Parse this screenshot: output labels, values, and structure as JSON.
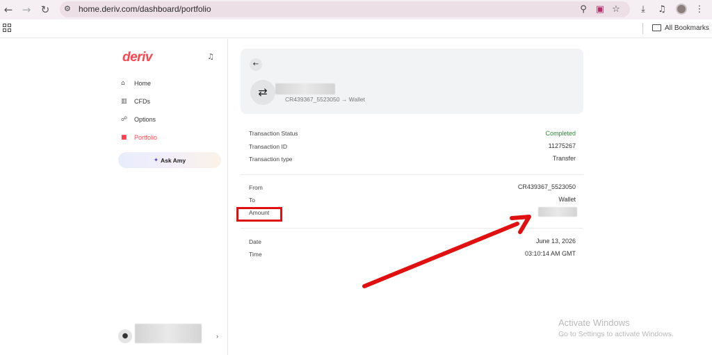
{
  "browser": {
    "url": "home.deriv.com/dashboard/portfolio",
    "bookmarks_label": "All Bookmarks"
  },
  "sidebar": {
    "logo": "deriv",
    "items": [
      {
        "label": "Home",
        "icon": "home-icon",
        "glyph": "⌂"
      },
      {
        "label": "CFDs",
        "icon": "chart-icon",
        "glyph": "▥"
      },
      {
        "label": "Options",
        "icon": "options-icon",
        "glyph": "☍"
      },
      {
        "label": "Portfolio",
        "icon": "wallet-icon",
        "glyph": "■",
        "active": true
      }
    ],
    "ask_label": "Ask Amy"
  },
  "transaction": {
    "route": "CR439367_5523050 → Wallet",
    "details": [
      {
        "label": "Transaction Status",
        "value": "Completed",
        "color": "#2e8b3a"
      },
      {
        "label": "Transaction ID",
        "value": "11275267"
      },
      {
        "label": "Transaction type",
        "value": "Transfer"
      }
    ],
    "transfer": [
      {
        "label": "From",
        "value": "CR439367_5523050"
      },
      {
        "label": "To",
        "value": "Wallet"
      },
      {
        "label": "Amount",
        "value": ""
      }
    ],
    "time": [
      {
        "label": "Date",
        "value": "June 13, 2026"
      },
      {
        "label": "Time",
        "value": "03:10:14 AM GMT"
      }
    ]
  },
  "watermark": {
    "title": "Activate Windows",
    "subtitle": "Go to Settings to activate Windows."
  },
  "colors": {
    "brand": "#ff444f",
    "annotation": "#e01010"
  }
}
